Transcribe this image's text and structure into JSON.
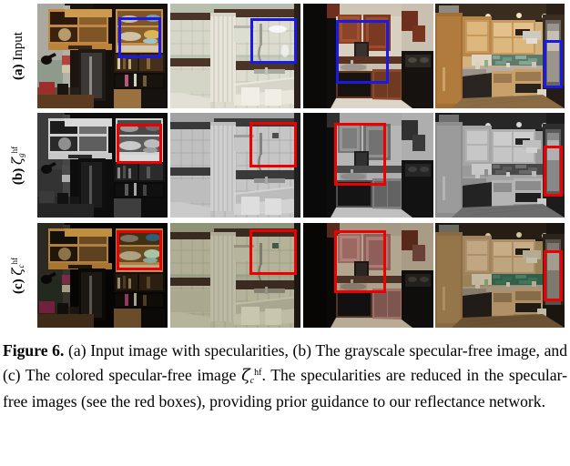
{
  "figure": {
    "rows": [
      {
        "tag": "(a)",
        "label": "Input",
        "has_symbol": false,
        "symbol": "",
        "sub": "",
        "sup": "",
        "name": "row-input"
      },
      {
        "tag": "(b)",
        "label": "",
        "has_symbol": true,
        "symbol": "ζ",
        "sub": "g",
        "sup": "hf",
        "name": "row-grayscale-specular-free"
      },
      {
        "tag": "(c)",
        "label": "",
        "has_symbol": true,
        "symbol": "ζ",
        "sub": "c",
        "sup": "hf",
        "name": "row-colored-specular-free"
      }
    ],
    "columns": [
      {
        "name": "column-kitchen-shelves"
      },
      {
        "name": "column-bathroom"
      },
      {
        "name": "column-kitchen-sink"
      },
      {
        "name": "column-kitchen-wide"
      }
    ],
    "box_colors": {
      "input_box": "#1a1ae6",
      "specular_box": "#ee0000"
    },
    "boxes": [
      {
        "row": 0,
        "col": 0,
        "color": "blue",
        "name": "highlight-box-input-shelf"
      },
      {
        "row": 0,
        "col": 1,
        "color": "blue",
        "name": "highlight-box-input-tile"
      },
      {
        "row": 0,
        "col": 2,
        "color": "blue",
        "name": "highlight-box-input-cabinet"
      },
      {
        "row": 0,
        "col": 3,
        "color": "blue",
        "name": "highlight-box-input-fridge"
      },
      {
        "row": 1,
        "col": 0,
        "color": "red",
        "name": "highlight-box-gray-shelf"
      },
      {
        "row": 1,
        "col": 1,
        "color": "red",
        "name": "highlight-box-gray-tile"
      },
      {
        "row": 1,
        "col": 2,
        "color": "red",
        "name": "highlight-box-gray-cabinet"
      },
      {
        "row": 1,
        "col": 3,
        "color": "red",
        "name": "highlight-box-gray-fridge"
      },
      {
        "row": 2,
        "col": 0,
        "color": "red",
        "name": "highlight-box-color-shelf"
      },
      {
        "row": 2,
        "col": 1,
        "color": "red",
        "name": "highlight-box-color-tile"
      },
      {
        "row": 2,
        "col": 2,
        "color": "red",
        "name": "highlight-box-color-cabinet"
      },
      {
        "row": 2,
        "col": 3,
        "color": "red",
        "name": "highlight-box-color-fridge"
      }
    ]
  },
  "caption": {
    "lead": "Figure 6.",
    "part1": " (a) Input image with specularities, (b) The grayscale specular-free image, and (c) The colored specular-free image ",
    "symbol": "ζ",
    "symbol_sub": "c",
    "symbol_sup": "hf",
    "part2": ". The specularities are reduced in the specular-free images (see the red boxes), providing prior guidance to our reflectance network."
  }
}
